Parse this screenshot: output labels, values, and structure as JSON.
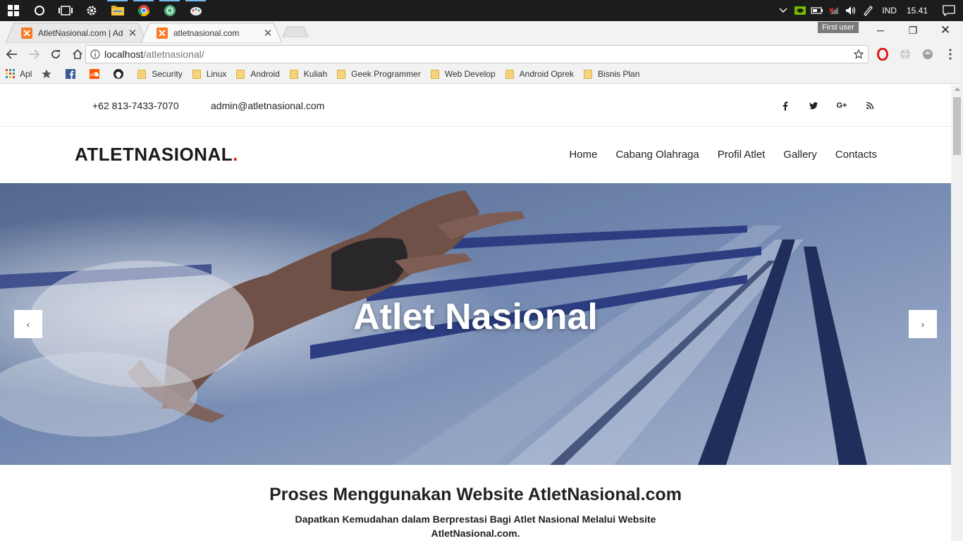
{
  "os": {
    "language": "IND",
    "clock": "15.41"
  },
  "browser": {
    "tabs": [
      {
        "title": "AtletNasional.com | Adm",
        "active": false
      },
      {
        "title": "atletnasional.com",
        "active": true
      }
    ],
    "user_badge": "First user",
    "address": {
      "host": "localhost",
      "path": "/atletnasional/"
    },
    "bookmarks": [
      {
        "label": "Apl",
        "kind": "apps-icon"
      },
      {
        "label": "",
        "kind": "star-icon"
      },
      {
        "label": "",
        "kind": "facebook-icon"
      },
      {
        "label": "",
        "kind": "soundcloud-icon"
      },
      {
        "label": "",
        "kind": "github-icon"
      },
      {
        "label": "Security",
        "kind": "folder-icon"
      },
      {
        "label": "Linux",
        "kind": "folder-icon"
      },
      {
        "label": "Android",
        "kind": "folder-icon"
      },
      {
        "label": "Kuliah",
        "kind": "folder-icon"
      },
      {
        "label": "Geek Programmer",
        "kind": "folder-icon"
      },
      {
        "label": "Web Develop",
        "kind": "folder-icon"
      },
      {
        "label": "Android Oprek",
        "kind": "folder-icon"
      },
      {
        "label": "Bisnis Plan",
        "kind": "folder-icon"
      }
    ]
  },
  "site": {
    "contact": {
      "phone": "+62 813-7433-7070",
      "email": "admin@atletnasional.com"
    },
    "social": [
      "f",
      "t",
      "G+",
      "rss"
    ],
    "logo_text": "ATLETNASIONAL",
    "logo_dot": ".",
    "menu": [
      "Home",
      "Cabang Olahraga",
      "Profil Atlet",
      "Gallery",
      "Contacts"
    ],
    "hero": {
      "title": "Atlet Nasional",
      "prev": "‹",
      "next": "›"
    },
    "section": {
      "heading": "Proses Menggunakan Website AtletNasional.com",
      "subtitle": "Dapatkan Kemudahan dalam Berprestasi Bagi Atlet Nasional Melalui Website AtletNasional.com."
    }
  },
  "colors": {
    "accent": "#e02020",
    "taskbar": "#1c1c1c",
    "chrome_bg": "#f2f2f2"
  }
}
